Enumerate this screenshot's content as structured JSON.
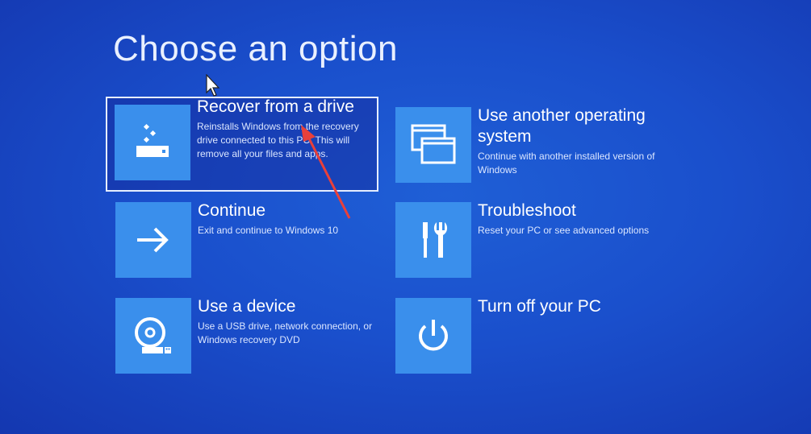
{
  "page_title": "Choose an option",
  "options": [
    {
      "id": "recover",
      "icon": "recovery-drive-icon",
      "title": "Recover from a drive",
      "description": "Reinstalls Windows from the recovery drive connected to this PC. This will remove all your files and apps."
    },
    {
      "id": "continue",
      "icon": "arrow-right-icon",
      "title": "Continue",
      "description": "Exit and continue to Windows 10"
    },
    {
      "id": "device",
      "icon": "disc-drive-icon",
      "title": "Use a device",
      "description": "Use a USB drive, network connection, or Windows recovery DVD"
    },
    {
      "id": "other",
      "icon": "windows-stack-icon",
      "title": "Use another operating system",
      "description": "Continue with another installed version of Windows"
    },
    {
      "id": "trouble",
      "icon": "tools-icon",
      "title": "Troubleshoot",
      "description": "Reset your PC or see advanced options"
    },
    {
      "id": "off",
      "icon": "power-icon",
      "title": "Turn off your PC",
      "description": ""
    }
  ],
  "colors": {
    "background": "#1a4fcc",
    "tile": "#3a8fec",
    "annotation_arrow": "#e8403a"
  }
}
